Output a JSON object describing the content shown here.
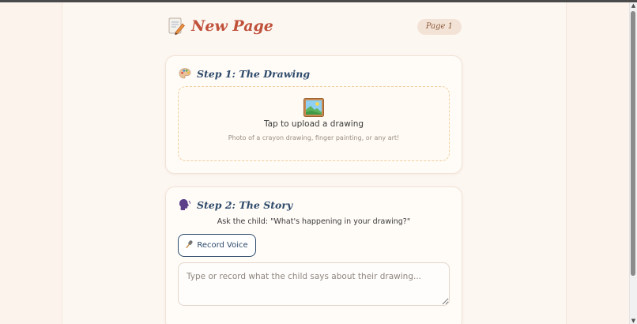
{
  "header": {
    "title": "New Page",
    "page_badge": "Page 1"
  },
  "step1": {
    "title": "Step 1: The Drawing",
    "upload_label": "Tap to upload a drawing",
    "upload_hint": "Photo of a crayon drawing, finger painting, or any art!"
  },
  "step2": {
    "title": "Step 2: The Story",
    "prompt": "Ask the child: \"What's happening in your drawing?\"",
    "record_label": "Record Voice",
    "story_placeholder": "Type or record what the child says about their drawing...",
    "story_value": ""
  },
  "icons": {
    "header": "memo-pencil-icon",
    "step1": "palette-icon",
    "step2": "speaking-head-icon",
    "upload": "framed-picture-icon",
    "record": "microphone-icon"
  },
  "colors": {
    "title_accent": "#c0513b",
    "step_title": "#2e4a6b",
    "upload_border": "#efcf9f",
    "background": "#fbf3ec"
  }
}
